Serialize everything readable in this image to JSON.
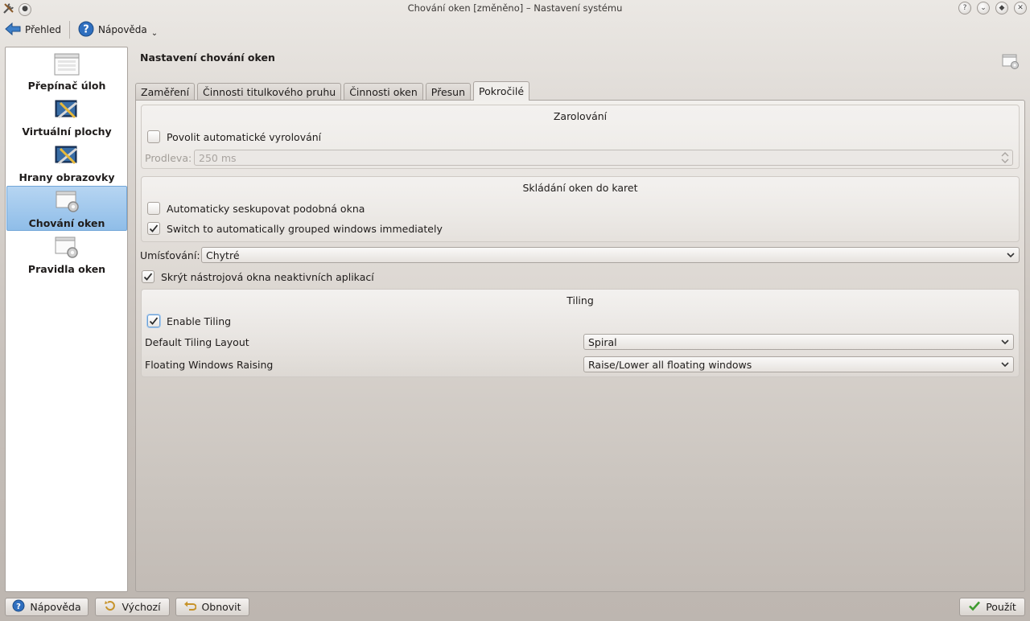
{
  "window": {
    "title": "Chování oken [změněno] – Nastavení systému"
  },
  "toolbar": {
    "overview_label": "Přehled",
    "help_label": "Nápověda"
  },
  "sidebar": {
    "items": [
      {
        "label": "Přepínač úloh",
        "icon": "window-list-icon",
        "selected": false
      },
      {
        "label": "Virtuální plochy",
        "icon": "desktop-tools-icon",
        "selected": false
      },
      {
        "label": "Hrany obrazovky",
        "icon": "desktop-tools-icon",
        "selected": false
      },
      {
        "label": "Chování oken",
        "icon": "window-gear-icon",
        "selected": true
      },
      {
        "label": "Pravidla oken",
        "icon": "window-gear-icon",
        "selected": false
      }
    ]
  },
  "main": {
    "title": "Nastavení chování oken",
    "tabs": [
      {
        "label": "Zaměření",
        "active": false
      },
      {
        "label": "Činnosti titulkového pruhu",
        "active": false
      },
      {
        "label": "Činnosti oken",
        "active": false
      },
      {
        "label": "Přesun",
        "active": false
      },
      {
        "label": "Pokročilé",
        "active": true
      }
    ],
    "shading": {
      "title": "Zarolování",
      "enable_label": "Povolit automatické vyrolování",
      "enable_checked": false,
      "delay_label": "Prodleva:",
      "delay_value": "250 ms"
    },
    "tabbing": {
      "title": "Skládání oken do karet",
      "autogroup_label": "Automaticky seskupovat podobná okna",
      "autogroup_checked": false,
      "switch_label": "Switch to automatically grouped windows immediately",
      "switch_checked": true
    },
    "placement": {
      "label": "Umísťování:",
      "value": "Chytré"
    },
    "hide_utility": {
      "label": "Skrýt nástrojová okna neaktivních aplikací",
      "checked": true
    },
    "tiling": {
      "title": "Tiling",
      "enable_label": "Enable Tiling",
      "enable_checked": true,
      "layout_label": "Default Tiling Layout",
      "layout_value": "Spiral",
      "raising_label": "Floating Windows Raising",
      "raising_value": "Raise/Lower all floating windows"
    }
  },
  "buttons": {
    "help": "Nápověda",
    "defaults": "Výchozí",
    "reset": "Obnovit",
    "apply": "Použít"
  },
  "colors": {
    "accent": "#8fbde8",
    "check": "#2b2b2b",
    "apply_check": "#3f9b2f"
  }
}
